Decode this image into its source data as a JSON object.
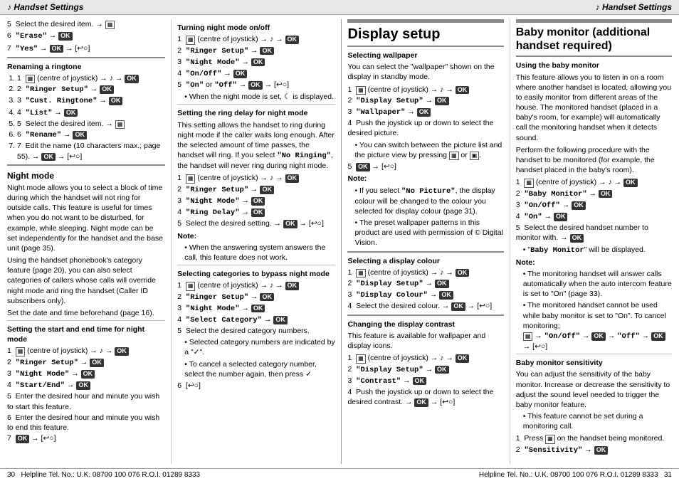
{
  "header": {
    "left": "♪ Handset Settings",
    "right": "♪ Handset Settings"
  },
  "footer": {
    "left_page": "30",
    "left_text": "Helpline Tel. No.: U.K. 08700 100 076  R.O.I. 01289 8333",
    "right_text": "Helpline Tel. No.: U.K. 08700 100 076  R.O.I. 01289 8333",
    "right_page": "31"
  },
  "col1": {
    "items_5_6_7": [
      "5  Select the desired item. →",
      "6  \"Erase\" →",
      "7  \"Yes\" → OK → [↩○]"
    ],
    "renaming_title": "Renaming a ringtone",
    "renaming_steps": [
      "1  (centre of joystick) → ♪ → OK",
      "2  \"Ringer Setup\" → OK",
      "3  \"Cust. Ringtone\" → OK",
      "4  \"List\" → OK",
      "5  Select the desired item. →",
      "6  \"Rename\" → OK",
      "7  Edit the name (10 characters max.; page 55). → OK → [↩○]"
    ],
    "night_mode_title": "Night mode",
    "night_mode_body": "Night mode allows you to select a block of time during which the handset will not ring for outside calls. This feature is useful for times when you do not want to be disturbed, for example, while sleeping. Night mode can be set independently for the handset and the base unit (page 35).",
    "night_mode_body2": "Using the handset phonebook's category feature (page 20), you can also select categories of callers whose calls will override night mode and ring the handset (Caller ID subscribers only).",
    "night_mode_body3": "Set the date and time beforehand (page 16).",
    "start_end_title": "Setting the start and end time for night mode",
    "start_end_steps": [
      "1  (centre of joystick) → ♪ → OK",
      "2  \"Ringer Setup\" → OK",
      "3  \"Night Mode\" → OK",
      "4  \"Start/End\" → OK",
      "5  Enter the desired hour and minute you wish to start this feature.",
      "6  Enter the desired hour and minute you wish to end this feature.",
      "7  OK → [↩○]"
    ]
  },
  "col2": {
    "turning_night_title": "Turning night mode on/off",
    "turning_night_steps": [
      "1  (centre of joystick) → ♪ → OK",
      "2  \"Ringer Setup\" → OK",
      "3  \"Night Mode\" → OK",
      "4  \"On/Off\" → OK",
      "5  \"On\" or \"Off\" → OK → [↩○]"
    ],
    "turning_night_note": "• When the night mode is set, ☾ is displayed.",
    "ring_delay_title": "Setting the ring delay for night mode",
    "ring_delay_body": "This setting allows the handset to ring during night mode if the caller waits long enough. After the selected amount of time passes, the handset will ring. If you select \"No Ringing\", the handset will never ring during night mode.",
    "ring_delay_steps": [
      "1  (centre of joystick) → ♪ → OK",
      "2  \"Ringer Setup\" → OK",
      "3  \"Night Mode\" → OK",
      "4  \"Ring Delay\" → OK",
      "5  Select the desired setting. → OK → [↩○]"
    ],
    "ring_delay_note": "• When the answering system answers the call, this feature does not work.",
    "bypass_title": "Selecting categories to bypass night mode",
    "bypass_steps": [
      "1  (centre of joystick) → ♪ → OK",
      "2  \"Ringer Setup\" → OK",
      "3  \"Night Mode\" → OK",
      "4  \"Select Category\" → OK",
      "5  Select the desired category numbers."
    ],
    "bypass_bullets": [
      "Selected category numbers are indicated by a \"✓\".",
      "To cancel a selected category number, select the number again, then press ✓"
    ],
    "bypass_step6": "6  [↩○]"
  },
  "col3": {
    "display_setup_title": "Display setup",
    "selecting_wallpaper_title": "Selecting wallpaper",
    "selecting_wallpaper_body": "You can select the \"wallpaper\" shown on the display in standby mode.",
    "wallpaper_steps": [
      "1  (centre of joystick) → ♪ → OK",
      "2  \"Display Setup\" → OK",
      "3  \"Wallpaper\" → OK",
      "4  Push the joystick up or down to select the desired picture."
    ],
    "wallpaper_bullets": [
      "You can switch between the picture list and the picture view by pressing  or .",
      ""
    ],
    "wallpaper_step5": "5  OK → [↩○]",
    "wallpaper_note1": "• If you select \"No Picture\", the display colour will be changed to the colour you selected for display colour (page 31).",
    "wallpaper_note2": "• The preset wallpaper patterns in this product are used with permission of © Digital Vision.",
    "select_display_title": "Selecting a display colour",
    "select_display_steps": [
      "1  (centre of joystick) → ♪ → OK",
      "2  \"Display Setup\" → OK",
      "3  \"Display Colour\" → OK",
      "4  Select the desired colour. → OK → [↩○]"
    ],
    "changing_contrast_title": "Changing the display contrast",
    "changing_contrast_body": "This feature is available for wallpaper and display icons.",
    "contrast_steps": [
      "1  (centre of joystick) → ♪ → OK",
      "2  \"Display Setup\" → OK",
      "3  \"Contrast\" → OK",
      "4  Push the joystick up or down to select the desired contrast. → OK → [↩○]"
    ]
  },
  "col4": {
    "baby_monitor_title": "Baby monitor (additional handset required)",
    "using_baby_title": "Using the baby monitor",
    "using_baby_body": "This feature allows you to listen in on a room where another handset is located, allowing you to easily monitor from different areas of the house. The monitored handset (placed in a baby's room, for example) will automatically call the monitoring handset when it detects sound.",
    "using_baby_body2": "Perform the following procedure with the handset to be monitored (for example, the handset placed in the baby's room).",
    "baby_steps": [
      "1  (centre of joystick) → ♪ → OK",
      "2  \"Baby Monitor\" → OK",
      "3  \"On/Off\" → OK",
      "4  \"On\" → OK",
      "5  Select the desired handset number to monitor with. → OK"
    ],
    "baby_bullet": "• \"Baby Monitor\" will be displayed.",
    "baby_note1": "• The monitoring handset will answer calls automatically when the auto intercom feature is set to \"On\" (page 33).",
    "baby_note2": "• The monitored handset cannot be used while baby monitor is set to \"On\". To cancel monitoring;",
    "baby_note2b": "  → \"On/Off\" → OK → \"Off\" → OK → [↩○]",
    "sensitivity_title": "Baby monitor sensitivity",
    "sensitivity_body": "You can adjust the sensitivity of the baby monitor. Increase or decrease the sensitivity to adjust the sound level needed to trigger the baby monitor feature.",
    "sensitivity_bullet": "• This feature cannot be set during a monitoring call.",
    "sensitivity_steps": [
      "1  Press  on the handset being monitored.",
      "2  \"Sensitivity\" → OK"
    ]
  }
}
